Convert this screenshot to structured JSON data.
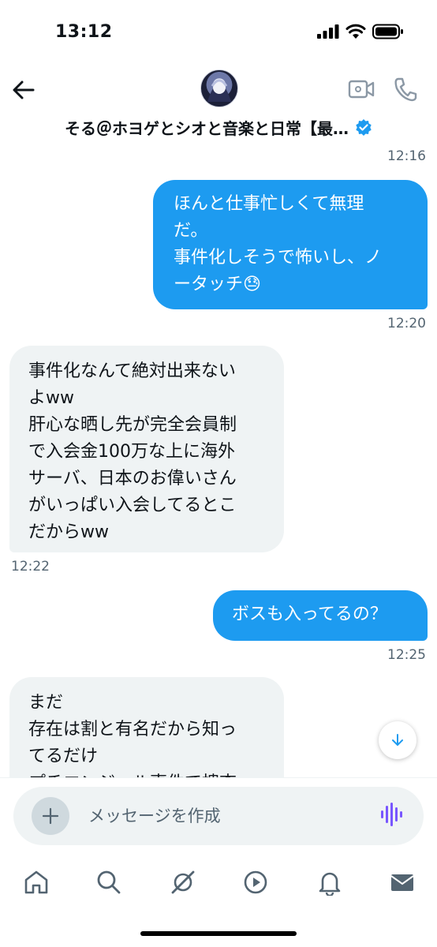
{
  "status_bar": {
    "time": "13:12"
  },
  "header": {
    "name": "そる＠ホヨゲとシオと音楽と日常【最…"
  },
  "messages": [
    {
      "direction": "out",
      "time": "12:16",
      "text": ""
    },
    {
      "direction": "out",
      "text": "ほんと仕事忙しくて無理\nだ。\n事件化しそうで怖いし、ノ\nータッチ😓",
      "time": "12:20"
    },
    {
      "direction": "in",
      "text": "事件化なんて絶対出来ない\nよww\n肝心な晒し先が完全会員制\nで入会金100万な上に海外\nサーバ、日本のお偉いさん\nがいっぱい入会してるとこ\nだからww",
      "time": "12:22"
    },
    {
      "direction": "out",
      "text": "ボスも入ってるの？",
      "time": "12:25"
    },
    {
      "direction": "in",
      "text": "まだ\n存在は割と有名だから知っ\nてるだけ\nプチエンジェル事件で捜査",
      "time": ""
    }
  ],
  "composer": {
    "placeholder": "メッセージを作成"
  },
  "icons": {
    "back": "arrow-left-icon",
    "video": "video-call-icon",
    "phone": "phone-icon",
    "verified": "verified-badge-icon",
    "scroll_down": "arrow-down-icon",
    "add": "plus-icon",
    "voice": "voice-wave-icon",
    "tabs": [
      "home-icon",
      "search-icon",
      "grok-icon",
      "video-play-icon",
      "bell-icon",
      "mail-icon"
    ]
  },
  "colors": {
    "accent": "#1d9bf0",
    "incoming_bubble": "#eff3f4",
    "text_primary": "#0f1419",
    "text_secondary": "#536471",
    "voice_icon": "#7856ff"
  }
}
